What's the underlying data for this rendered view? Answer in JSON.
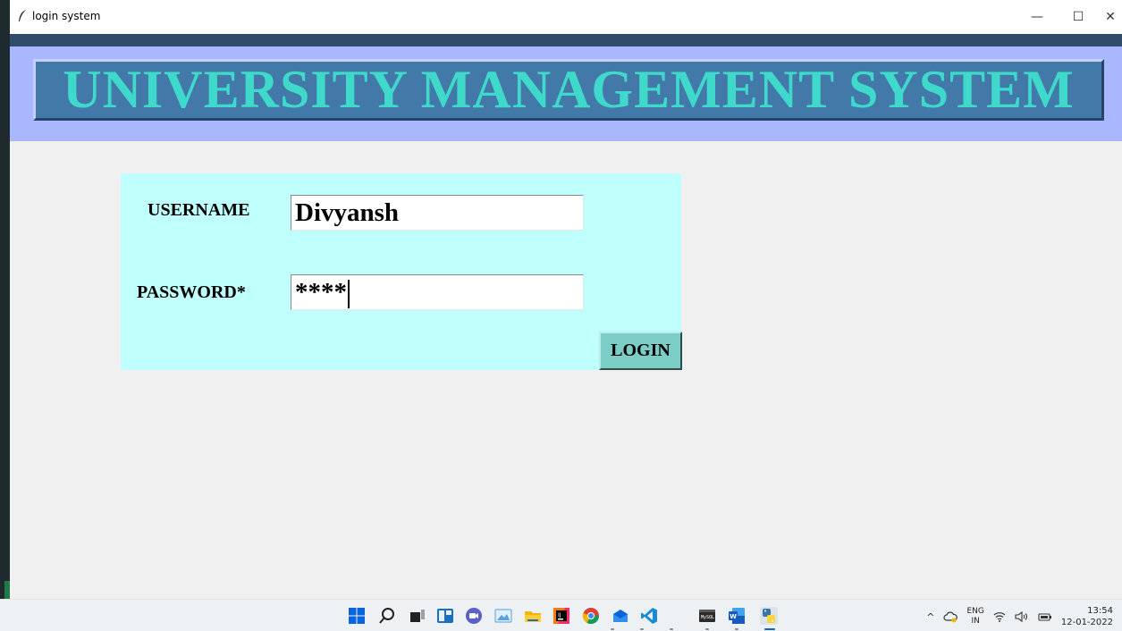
{
  "window": {
    "title": "login system",
    "minimize_glyph": "—",
    "maximize_glyph": "☐",
    "close_glyph": "✕"
  },
  "header": {
    "title": "UNIVERSITY MANAGEMENT SYSTEM"
  },
  "login_form": {
    "username_label": "USERNAME",
    "username_value": "Divyansh",
    "password_label": "PASSWORD*",
    "password_masked": "****",
    "login_button": "LOGIN"
  },
  "taskbar": {
    "icons": [
      "start-icon",
      "search-icon",
      "task-view-icon",
      "widgets-icon",
      "teams-chat-icon",
      "photos-icon",
      "file-explorer-icon",
      "intellij-icon",
      "chrome-icon",
      "mail-icon",
      "vscode-icon",
      "terminal-icon",
      "word-icon",
      "python-icon"
    ],
    "tray": {
      "chevron": "^",
      "lang_top": "ENG",
      "lang_bottom": "IN",
      "wifi_glyph": "◠",
      "volume_glyph": "◁))",
      "time": "13:54",
      "date": "12-01-2022"
    }
  },
  "colors": {
    "header_title": "#3fd9cc",
    "panel_bg": "#bffffc",
    "login_button_bg": "#7ccdc6",
    "banner_frame": "#a8b7ff",
    "banner_inner": "#4379a8"
  }
}
